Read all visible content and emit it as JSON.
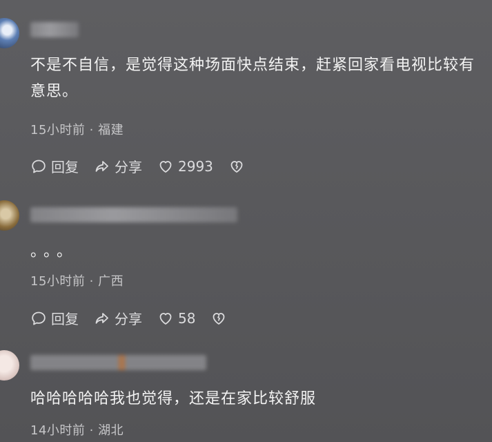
{
  "comments": [
    {
      "text": "不是不自信，是觉得这种场面快点结束，赶紧回家看电视比较有意思。",
      "time": "15小时前",
      "location": "福建",
      "reply_label": "回复",
      "share_label": "分享",
      "likes": "2993"
    },
    {
      "text": "。。。",
      "time": "15小时前",
      "location": "广西",
      "reply_label": "回复",
      "share_label": "分享",
      "likes": "58"
    },
    {
      "text": "哈哈哈哈哈我也觉得，还是在家比较舒服",
      "time": "14小时前",
      "location": "湖北"
    }
  ],
  "meta_separator": "·"
}
